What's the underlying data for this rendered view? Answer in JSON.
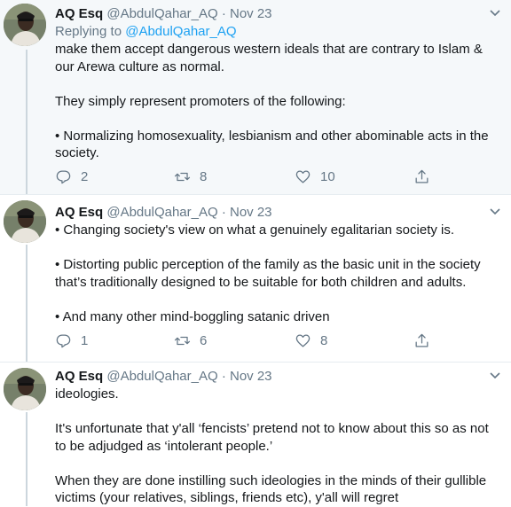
{
  "tweets": [
    {
      "name": "AQ Esq",
      "handle": "@AbdulQahar_AQ",
      "dot": "·",
      "date": "Nov 23",
      "reply_prefix": "Replying to",
      "reply_handle": "@AbdulQahar_AQ",
      "paragraphs": [
        "make them accept dangerous western ideals that are contrary to Islam & our Arewa culture as normal.",
        "They simply represent promoters of the following:",
        "• Normalizing homosexuality, lesbianism and other abominable acts in the society."
      ],
      "replies": "2",
      "retweets": "8",
      "likes": "10"
    },
    {
      "name": "AQ Esq",
      "handle": "@AbdulQahar_AQ",
      "dot": "·",
      "date": "Nov 23",
      "paragraphs": [
        "• Changing society's view on what a genuinely egalitarian society is.",
        "• Distorting public perception of the family as the basic unit in the society that’s traditionally designed to be suitable for both children and adults.",
        "• And many other mind-boggling satanic driven"
      ],
      "replies": "1",
      "retweets": "6",
      "likes": "8"
    },
    {
      "name": "AQ Esq",
      "handle": "@AbdulQahar_AQ",
      "dot": "·",
      "date": "Nov 23",
      "paragraphs": [
        "ideologies.",
        "It's unfortunate that y'all ‘fencists’ pretend not to know about this so as not to be adjudged as ‘intolerant people.’",
        "When they are done instilling such ideologies in the minds of their gullible victims (your relatives, siblings, friends etc), y'all will regret"
      ]
    }
  ],
  "icons": {
    "reply": "reply-icon",
    "retweet": "retweet-icon",
    "like": "heart-icon",
    "share": "share-icon",
    "more": "chevron-down-icon"
  },
  "colors": {
    "link": "#1da1f2",
    "secondary": "#657786",
    "thread_line": "#ccd6dd",
    "highlight_bg": "#f5f8fa"
  }
}
